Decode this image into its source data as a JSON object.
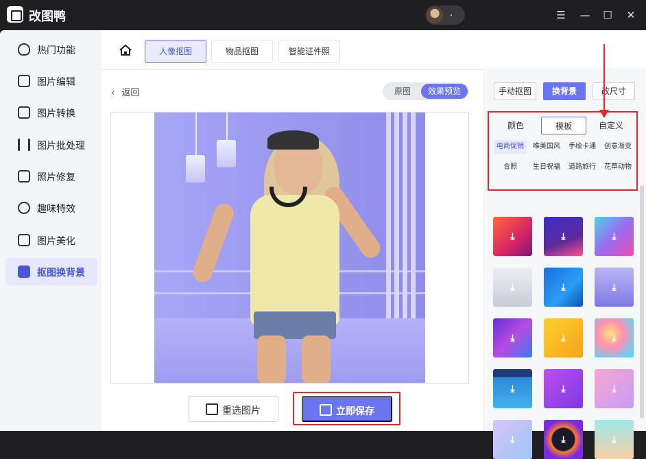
{
  "app": {
    "title": "改图鸭",
    "user_name": "."
  },
  "window_controls": {
    "menu": "☰",
    "minimize": "—",
    "maximize": "☐",
    "close": "✕"
  },
  "sidebar": {
    "items": [
      {
        "label": "热门功能",
        "icon": "flame-icon"
      },
      {
        "label": "图片编辑",
        "icon": "image-edit-icon"
      },
      {
        "label": "图片转换",
        "icon": "convert-icon"
      },
      {
        "label": "图片批处理",
        "icon": "batch-icon"
      },
      {
        "label": "照片修复",
        "icon": "repair-icon"
      },
      {
        "label": "趣味特效",
        "icon": "magic-icon"
      },
      {
        "label": "图片美化",
        "icon": "beautify-icon"
      },
      {
        "label": "抠图换背景",
        "icon": "cutout-icon"
      }
    ],
    "active_index": 7
  },
  "topnav": {
    "tabs": [
      {
        "label": "人像抠图"
      },
      {
        "label": "物品抠图"
      },
      {
        "label": "智能证件照"
      }
    ],
    "active_index": 0
  },
  "editor": {
    "back_label": "返回",
    "view_toggle": {
      "original": "原图",
      "preview": "效果预览",
      "active": "preview"
    },
    "buttons": {
      "reselect": "重选图片",
      "save": "立即保存"
    }
  },
  "right_panel": {
    "mode_buttons": [
      {
        "label": "手动抠图"
      },
      {
        "label": "换背景"
      },
      {
        "label": "改尺寸"
      }
    ],
    "active_mode": 1,
    "sub_tabs": [
      {
        "label": "颜色"
      },
      {
        "label": "模板"
      },
      {
        "label": "自定义"
      }
    ],
    "active_sub_tab": 1,
    "categories": [
      {
        "label": "电商促销"
      },
      {
        "label": "唯美国风"
      },
      {
        "label": "手绘卡通"
      },
      {
        "label": "创意渐变"
      },
      {
        "label": "合照"
      },
      {
        "label": "生日祝福"
      },
      {
        "label": "道路旅行"
      },
      {
        "label": "花草动物"
      }
    ],
    "active_category": 0,
    "download_glyph": "⤓"
  },
  "colors": {
    "accent": "#6c75f0",
    "highlight": "#e0282e"
  }
}
